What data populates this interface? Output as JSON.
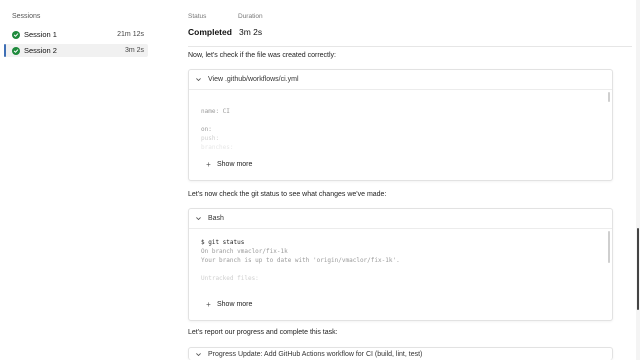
{
  "sidebar": {
    "title": "Sessions",
    "sessions": [
      {
        "name": "Session 1",
        "duration": "21m 12s"
      },
      {
        "name": "Session 2",
        "duration": "3m 2s",
        "selected": true
      }
    ]
  },
  "main": {
    "status_label": "Status",
    "duration_label": "Duration",
    "status_value": "Completed",
    "duration_value": "3m 2s",
    "messages": [
      "Now, let's check if the file was created correctly:",
      "Let's now check the git status to see what changes we've made:",
      "Let's report our progress and complete this task:"
    ],
    "cards": [
      {
        "title": "View .github/workflows/ci.yml",
        "code_lines": [
          "name: CI",
          "",
          "on:",
          "  push:",
          "    branches:"
        ],
        "show_more": "Show more"
      },
      {
        "title": "Bash",
        "code_lines": [
          "$ git status",
          "On branch vmaclor/fix-1k",
          "Your branch is up to date with 'origin/vmaclor/fix-1k'.",
          "",
          "Untracked files:"
        ],
        "show_more": "Show more"
      },
      {
        "title": "Progress Update: Add GitHub Actions workflow for CI (build, lint, test)"
      }
    ]
  },
  "colors": {
    "success": "#1e8a3c",
    "selected_accent": "#3f6fb5",
    "selected_bg": "#f1f1f1"
  },
  "icons": [
    "check-circle-icon",
    "chevron-down-icon",
    "plus-icon"
  ]
}
